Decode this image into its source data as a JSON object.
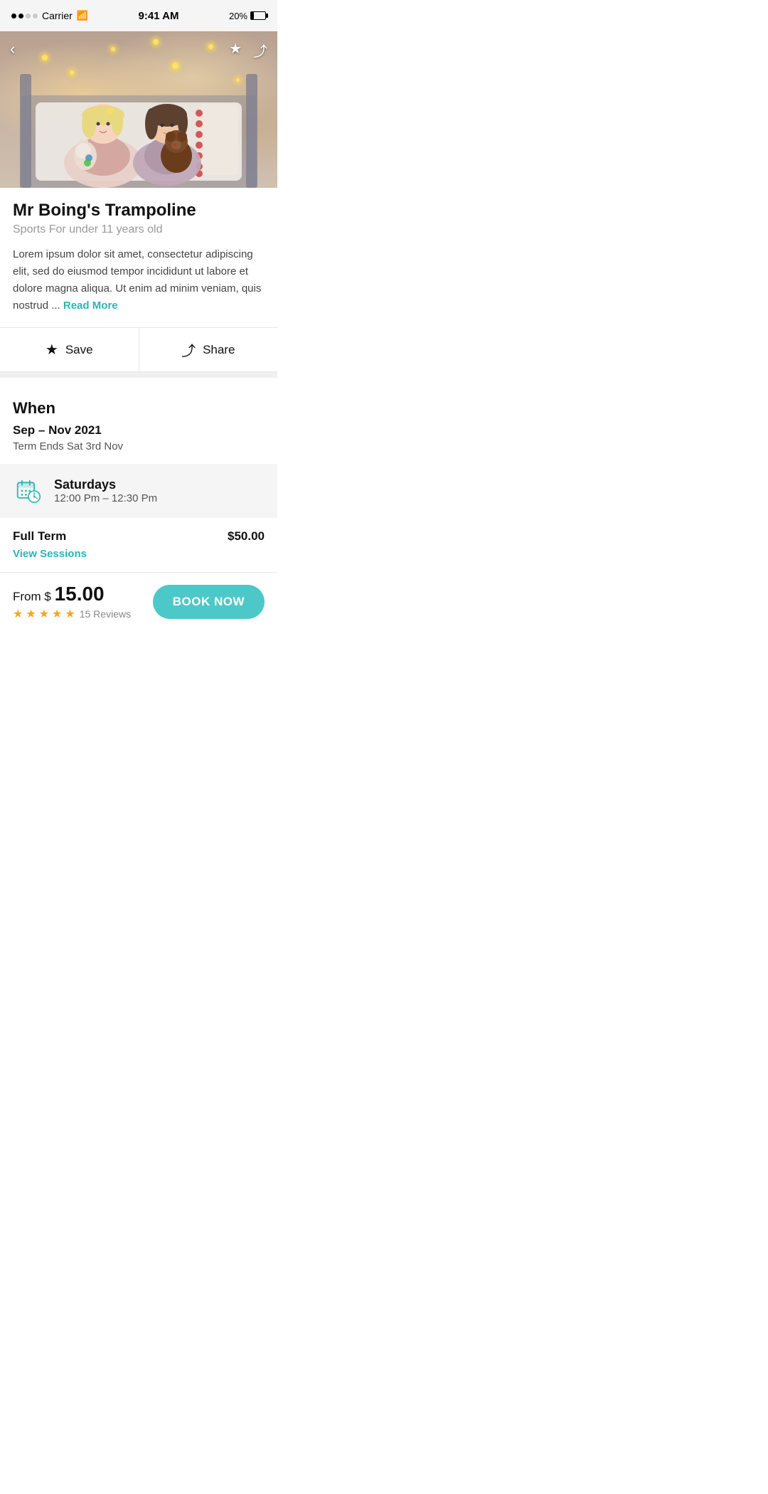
{
  "status_bar": {
    "carrier": "Carrier",
    "time": "9:41 AM",
    "battery": "20%"
  },
  "nav": {
    "back_label": "‹",
    "bookmark_icon": "bookmark",
    "share_icon": "share"
  },
  "hero": {
    "alt": "Two children sitting on a bed with stuffed animals"
  },
  "activity": {
    "title": "Mr Boing's Trampoline",
    "subtitle": "Sports For under 11 years old",
    "description": "Lorem ipsum dolor sit amet, consectetur adipiscing elit, sed do eiusmod tempor incididunt ut labore et dolore magna aliqua. Ut enim ad minim veniam, quis nostrud ...",
    "read_more": "Read More"
  },
  "actions": {
    "save_label": "Save",
    "share_label": "Share"
  },
  "when": {
    "section_title": "When",
    "date_range": "Sep – Nov 2021",
    "term_end": "Term Ends Sat 3rd Nov"
  },
  "schedule": {
    "day": "Saturdays",
    "time": "12:00 Pm – 12:30 Pm"
  },
  "pricing": {
    "label": "Full Term",
    "value": "$50.00",
    "view_sessions_label": "View Sessions"
  },
  "bottom_bar": {
    "from_label": "From $",
    "price": "15.00",
    "stars": 5,
    "reviews_count": "15 Reviews",
    "book_label": "BOOK NOW"
  }
}
